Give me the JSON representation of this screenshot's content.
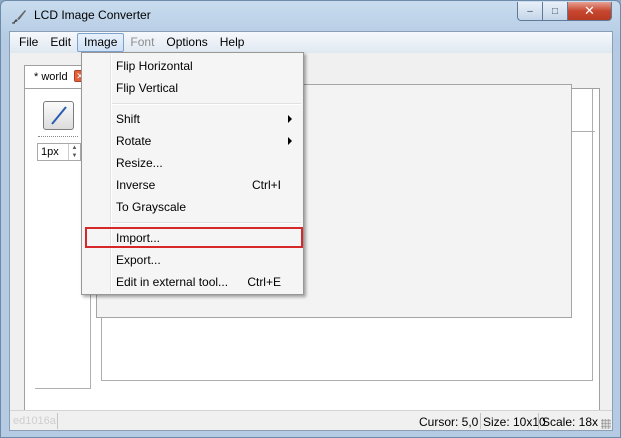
{
  "window": {
    "title": "LCD Image Converter",
    "app_icon": "brush-icon"
  },
  "caption_buttons": {
    "minimize": "–",
    "maximize": "□",
    "close": "✕"
  },
  "menubar": {
    "items": [
      {
        "label": "File",
        "disabled": false
      },
      {
        "label": "Edit",
        "disabled": false
      },
      {
        "label": "Image",
        "disabled": false,
        "open": true
      },
      {
        "label": "Font",
        "disabled": true
      },
      {
        "label": "Options",
        "disabled": false
      },
      {
        "label": "Help",
        "disabled": false
      }
    ]
  },
  "tabs": [
    {
      "label": "* world",
      "close_icon": "close-icon"
    }
  ],
  "tools": {
    "pen_icon": "pen-icon",
    "size_value": "1px"
  },
  "image_menu": {
    "items": [
      {
        "label": "Flip Horizontal",
        "shortcut": "",
        "submenu": false
      },
      {
        "label": "Flip Vertical",
        "shortcut": "",
        "submenu": false
      },
      {
        "label": "Shift",
        "shortcut": "",
        "submenu": true
      },
      {
        "label": "Rotate",
        "shortcut": "",
        "submenu": true
      },
      {
        "label": "Resize...",
        "shortcut": "",
        "submenu": false
      },
      {
        "label": "Inverse",
        "shortcut": "Ctrl+I",
        "submenu": false
      },
      {
        "label": "To Grayscale",
        "shortcut": "",
        "submenu": false
      },
      {
        "label": "Import...",
        "shortcut": "",
        "submenu": false,
        "highlighted": true
      },
      {
        "label": "Export...",
        "shortcut": "",
        "submenu": false
      },
      {
        "label": "Edit in external tool...",
        "shortcut": "Ctrl+E",
        "submenu": false
      }
    ]
  },
  "status": {
    "left": "ed1016a",
    "cursor": "Cursor: 5,0",
    "size": "Size: 10x10",
    "scale": "Scale: 18x"
  },
  "colors": {
    "pixel_on": "#000080",
    "highlight": "#d62828"
  }
}
